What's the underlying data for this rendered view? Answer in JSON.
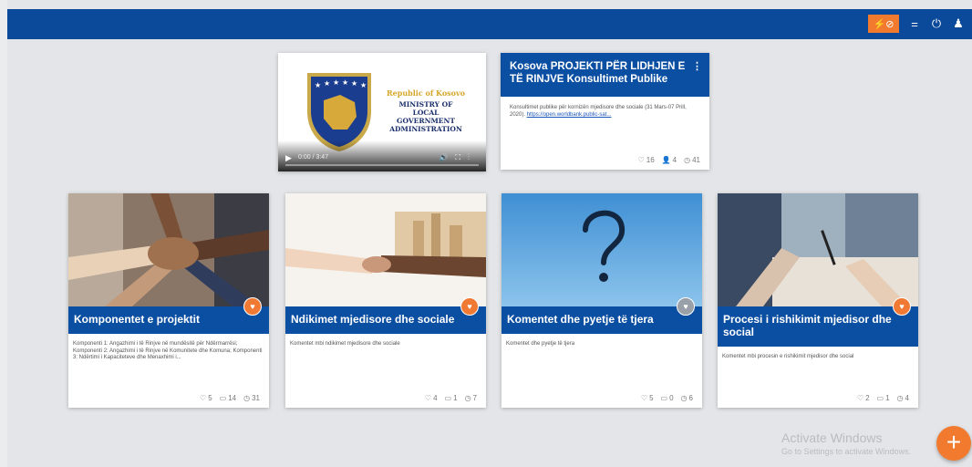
{
  "toolbar": {
    "orange_icons": "⚡⊘",
    "menu_icon": "=",
    "power_icon": "⏻",
    "user_icon": "♟"
  },
  "video": {
    "republic": "Republic of Kosovo",
    "ministry_lines": [
      "MINISTRY OF",
      "LOCAL",
      "GOVERNMENT",
      "ADMINISTRATION"
    ],
    "play_icon": "▶",
    "time": "0:00 / 3:47"
  },
  "info_card": {
    "title": "Kosova PROJEKTI PËR LIDHJEN E TË RINJVE Konsultimet Publike",
    "description": "Konsultimet publike për kornizën mjedisore dhe sociale (31 Mars-07 Prill, 2020).",
    "link_text": "https://open.worldbank.public-sat...",
    "stats": {
      "comments": "16",
      "participants": "4",
      "views": "41"
    }
  },
  "cards": [
    {
      "title": "Komponentet e projektit",
      "description": "Komponenti 1: Angazhimi i të Rinjve në mundësitë për Ndërmarrësi; Komponenti 2: Angazhimi i të Rinjve në Komunitete dhe Komuna; Komponenti 3: Ndërtimi i Kapaciteteve dhe Menaxhimi i...",
      "stats": {
        "comments": "5",
        "posts": "14",
        "views": "31"
      }
    },
    {
      "title": "Ndikimet mjedisore dhe sociale",
      "description": "Komentet mbi ndikimet mjedisore dhe sociale",
      "stats": {
        "comments": "4",
        "posts": "1",
        "views": "7"
      }
    },
    {
      "title": "Komentet dhe pyetje të tjera",
      "description": "Komentet dhe pyetje të tjera",
      "stats": {
        "comments": "5",
        "posts": "0",
        "views": "6"
      }
    },
    {
      "title": "Procesi i rishikimit mjedisor dhe social",
      "description": "Komentet mbi procesin e rishikimit mjedisor dhe social",
      "stats": {
        "comments": "2",
        "posts": "1",
        "views": "4"
      }
    }
  ],
  "icons": {
    "comment": "♡",
    "post": "▭",
    "views": "◷",
    "people": "👥",
    "heart": "♥",
    "kebab": "⋮"
  },
  "fab": {
    "label": "+"
  },
  "watermark": {
    "line1": "Activate Windows",
    "line2": "Go to Settings to activate Windows."
  },
  "colors": {
    "primary": "#0b4fa3",
    "accent": "#f27a2e"
  }
}
